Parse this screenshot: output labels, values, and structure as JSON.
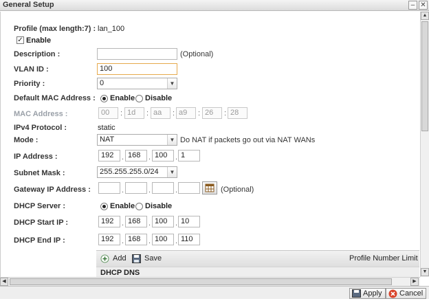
{
  "window": {
    "title": "General Setup"
  },
  "form": {
    "profile": {
      "label": "Profile (max length:7) :",
      "value": "lan_100"
    },
    "enable": {
      "label": "Enable",
      "checked": true
    },
    "description": {
      "label": "Description :",
      "value": "",
      "note": "(Optional)"
    },
    "vlan_id": {
      "label": "VLAN ID :",
      "value": "100"
    },
    "priority": {
      "label": "Priority :",
      "value": "0"
    },
    "default_mac": {
      "label": "Default MAC Address :",
      "option_enable": "Enable",
      "option_disable": "Disable",
      "selected": "Enable"
    },
    "mac_address": {
      "label": "MAC Address :",
      "octets": [
        "00",
        "1d",
        "aa",
        "a9",
        "26",
        "28"
      ]
    },
    "ipv4_protocol": {
      "label": "IPv4 Protocol :",
      "value": "static"
    },
    "mode": {
      "label": "Mode :",
      "value": "NAT",
      "note": "Do NAT if packets go out via NAT WANs"
    },
    "ip_address": {
      "label": "IP Address :",
      "octets": [
        "192",
        "168",
        "100",
        "1"
      ]
    },
    "subnet_mask": {
      "label": "Subnet Mask :",
      "value": "255.255.255.0/24"
    },
    "gateway": {
      "label": "Gateway IP Address :",
      "octets": [
        "",
        "",
        "",
        ""
      ],
      "note": "(Optional)"
    },
    "dhcp_server": {
      "label": "DHCP Server :",
      "option_enable": "Enable",
      "option_disable": "Disable",
      "selected": "Enable"
    },
    "dhcp_start": {
      "label": "DHCP Start IP :",
      "octets": [
        "192",
        "168",
        "100",
        "10"
      ]
    },
    "dhcp_end": {
      "label": "DHCP End IP :",
      "octets": [
        "192",
        "168",
        "100",
        "110"
      ]
    }
  },
  "profile_toolbar": {
    "add_label": "Add",
    "save_label": "Save",
    "limit_label": "Profile Number Limit :"
  },
  "dhcp_dns": {
    "label": "DHCP DNS"
  },
  "footer": {
    "apply_label": "Apply",
    "cancel_label": "Cancel"
  },
  "icons": {
    "grid": "grid-icon",
    "add": "add-icon",
    "save": "save-icon",
    "apply": "apply-icon",
    "cancel": "cancel-icon"
  },
  "colors": {
    "focus_border": "#e6a94b",
    "cancel_icon": "#d9442b",
    "grid_icon": "#8a5a1e"
  }
}
